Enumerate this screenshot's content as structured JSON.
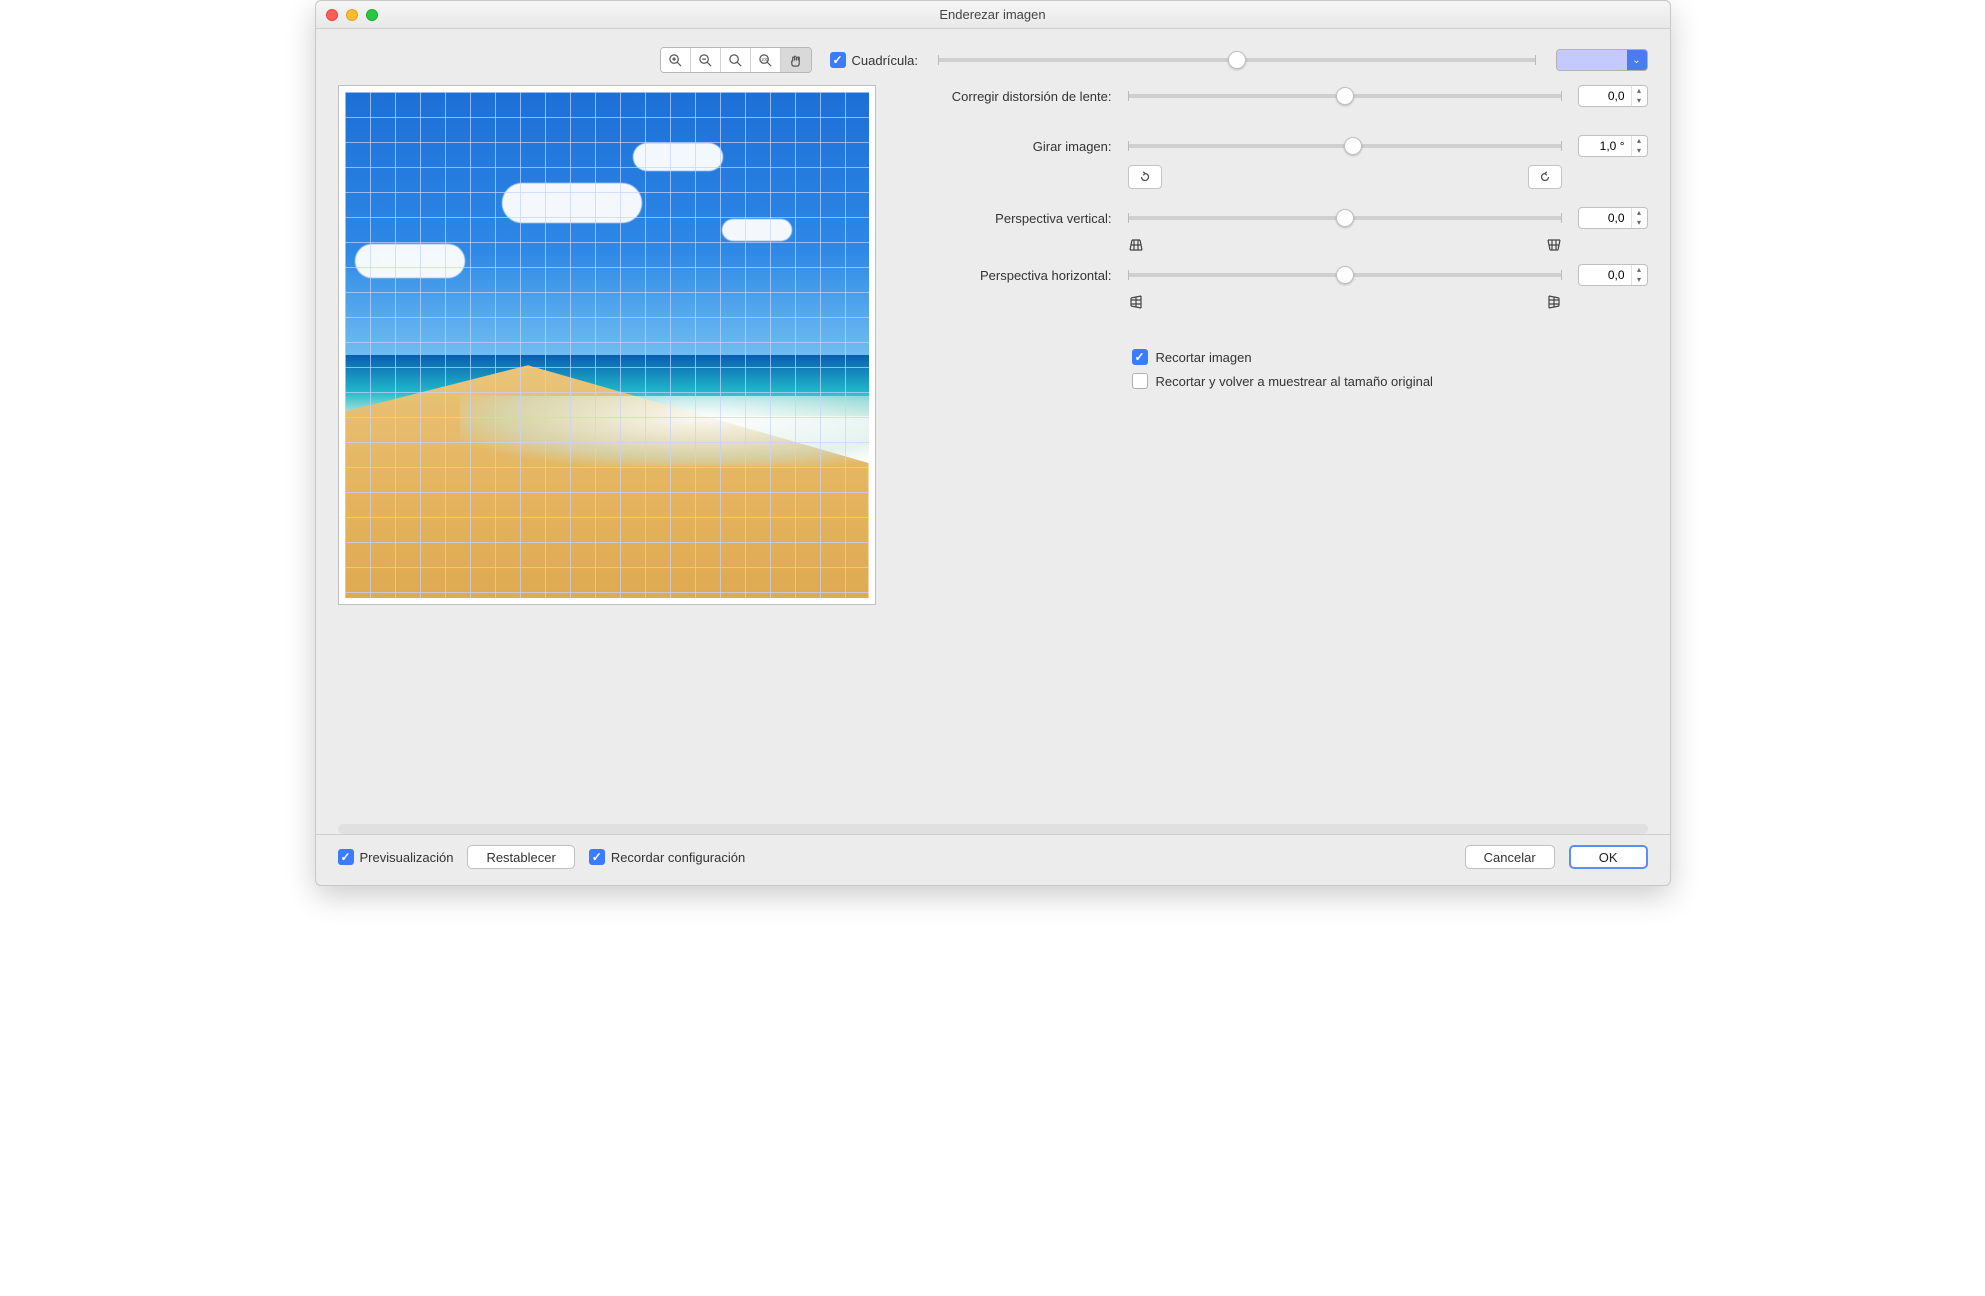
{
  "window": {
    "title": "Enderezar imagen"
  },
  "toolbar": {
    "gridCheckbox": {
      "label": "Cuadrícula:",
      "checked": true
    },
    "gridSliderPercent": 50,
    "gridColor": "#c4c9ff"
  },
  "sliders": {
    "lens": {
      "label": "Corregir distorsión de lente:",
      "value": "0,0",
      "percent": 50
    },
    "rotate": {
      "label": "Girar imagen:",
      "value": "1,0 °",
      "percent": 52
    },
    "pvert": {
      "label": "Perspectiva vertical:",
      "value": "0,0",
      "percent": 50
    },
    "phorz": {
      "label": "Perspectiva horizontal:",
      "value": "0,0",
      "percent": 50
    }
  },
  "checks": {
    "crop": {
      "label": "Recortar imagen",
      "checked": true
    },
    "resample": {
      "label": "Recortar y volver a muestrear al tamaño original",
      "checked": false
    }
  },
  "footer": {
    "preview": {
      "label": "Previsualización",
      "checked": true
    },
    "reset": "Restablecer",
    "remember": {
      "label": "Recordar configuración",
      "checked": true
    },
    "cancel": "Cancelar",
    "ok": "OK"
  }
}
